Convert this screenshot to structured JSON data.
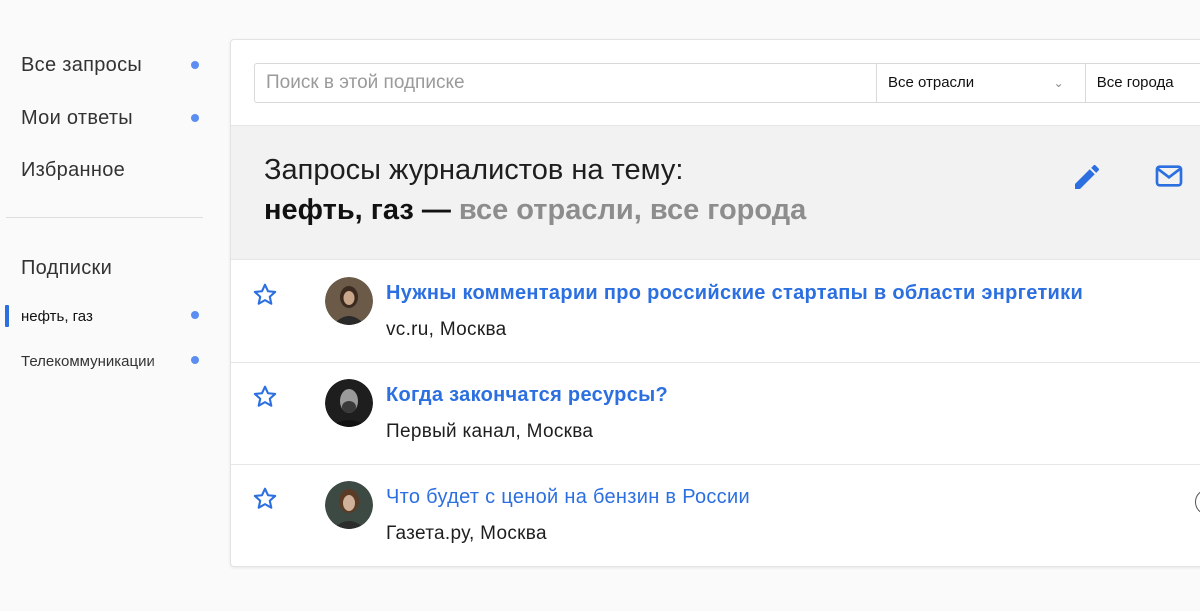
{
  "sidebar": {
    "items": [
      {
        "label": "Все запросы",
        "has_dot": true
      },
      {
        "label": "Мои ответы",
        "has_dot": true
      },
      {
        "label": "Избранное",
        "has_dot": false
      }
    ],
    "subscriptions_heading": "Подписки",
    "subscriptions": [
      {
        "label": "нефть, газ",
        "active": true,
        "has_dot": true
      },
      {
        "label": "Телекоммуникации",
        "active": false,
        "has_dot": true
      }
    ]
  },
  "filters": {
    "search_placeholder": "Поиск в этой подписке",
    "search_value": "",
    "sector_select": "Все отрасли",
    "city_select": "Все города"
  },
  "header": {
    "line1": "Запросы журналистов на тему:",
    "topic": "нефть, газ —",
    "scope": " все отрасли, все города",
    "edit_icon": "pencil-icon",
    "mail_icon": "envelope-icon"
  },
  "requests": [
    {
      "title": "Нужны комментарии про российские стартапы в области энргетики",
      "source": "vc.ru, Москва",
      "unread": true
    },
    {
      "title": "Когда закончатся ресурсы?",
      "source": "Первый канал, Москва",
      "unread": true
    },
    {
      "title": "Что будет с ценой на бензин в России",
      "source": "Газета.ру, Москва",
      "unread": false
    }
  ],
  "colors": {
    "accent": "#2b6fe0",
    "dot": "#5b8ef0",
    "muted_text": "#8d8d8d",
    "header_band": "#f2f2f2"
  }
}
